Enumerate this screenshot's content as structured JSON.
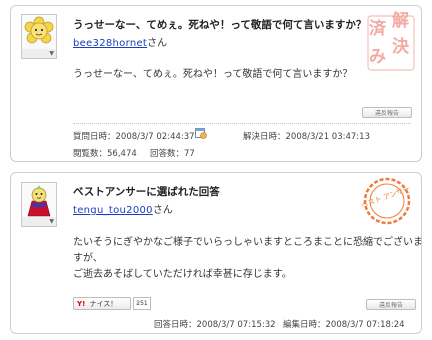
{
  "question": {
    "title": "うっせーなー、てめぇ。死ねや！って敬語で何て言いますか？",
    "username": "bee328hornet",
    "honorific": "さん",
    "body": "うっせーなー、てめぇ。死ねや！って敬語で何て言いますか？",
    "report_label": "違反報告",
    "stamp_chars": [
      "済",
      "解",
      "み",
      "決"
    ],
    "posted_label": "質問日時：",
    "posted_value": "2008/3/7 02:44:37",
    "resolved_label": "解決日時：",
    "resolved_value": "2008/3/21 03:47:13",
    "views_label": "閲覧数：",
    "views_value": "56,474",
    "answers_label": "回答数：",
    "answers_value": "77"
  },
  "answer": {
    "title": "ベストアンサーに選ばれた回答",
    "username": "tengu_tou2000",
    "honorific": "さん",
    "body_lines": [
      "たいそうにぎやかなご様子でいらっしゃいますところまことに恐縮でございま",
      "すが、",
      "ご逝去あそばしていただければ幸甚に存じます。"
    ],
    "badge_text": "ベスト アンサー",
    "nice_logo": "Y!",
    "nice_label": "ナイス！",
    "nice_count": "251",
    "report_label": "違反報告",
    "answered_label": "回答日時：",
    "answered_value": "2008/3/7 07:15:32",
    "edited_label": "編集日時：",
    "edited_value": "2008/3/7 07:18:24"
  },
  "colors": {
    "link": "#1a3dc1",
    "stamp": "#f2aaa2",
    "badge": "#f07a3c",
    "border": "#cfcfcf"
  }
}
